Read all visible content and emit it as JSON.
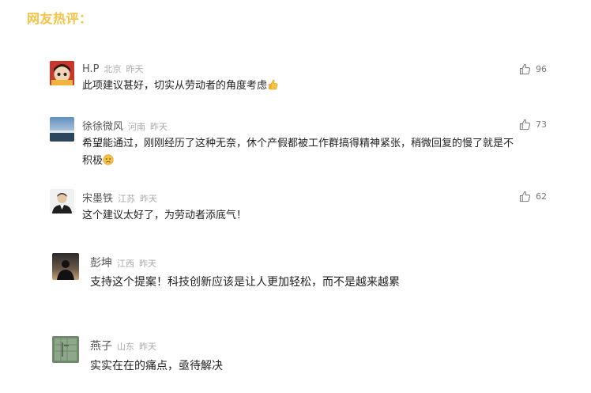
{
  "section_title": "网友热评：",
  "comments": [
    {
      "name": "H.P",
      "location": "北京",
      "time": "昨天",
      "text": "此项建议甚好，切实从劳动者的角度考虑",
      "likes": "96"
    },
    {
      "name": "徐徐微风",
      "location": "河南",
      "time": "昨天",
      "text_line1": "希望能通过，刚刚经历了这种无奈，休个产假都被工作群搞得精神紧张，稍微回复的慢了就是不",
      "text_line2": "积极",
      "likes": "73"
    },
    {
      "name": "宋墨铁",
      "location": "江苏",
      "time": "昨天",
      "text": "这个建议太好了，为劳动者添底气！",
      "likes": "62"
    },
    {
      "name": "彭坤",
      "location": "江西",
      "time": "昨天",
      "text": "支持这个提案！科技创新应该是让人更加轻松，而不是越来越累"
    },
    {
      "name": "燕子",
      "location": "山东",
      "time": "昨天",
      "text": "实实在在的痛点，亟待解决"
    }
  ],
  "colors": {
    "title": "#f6c343",
    "name": "#555555",
    "meta": "#aaaaaa",
    "text": "#222222"
  },
  "icons": {
    "like": "thumbs-up-icon",
    "emoji_1": "thumbs-up-emoji",
    "emoji_2": "sad-face-emoji"
  }
}
